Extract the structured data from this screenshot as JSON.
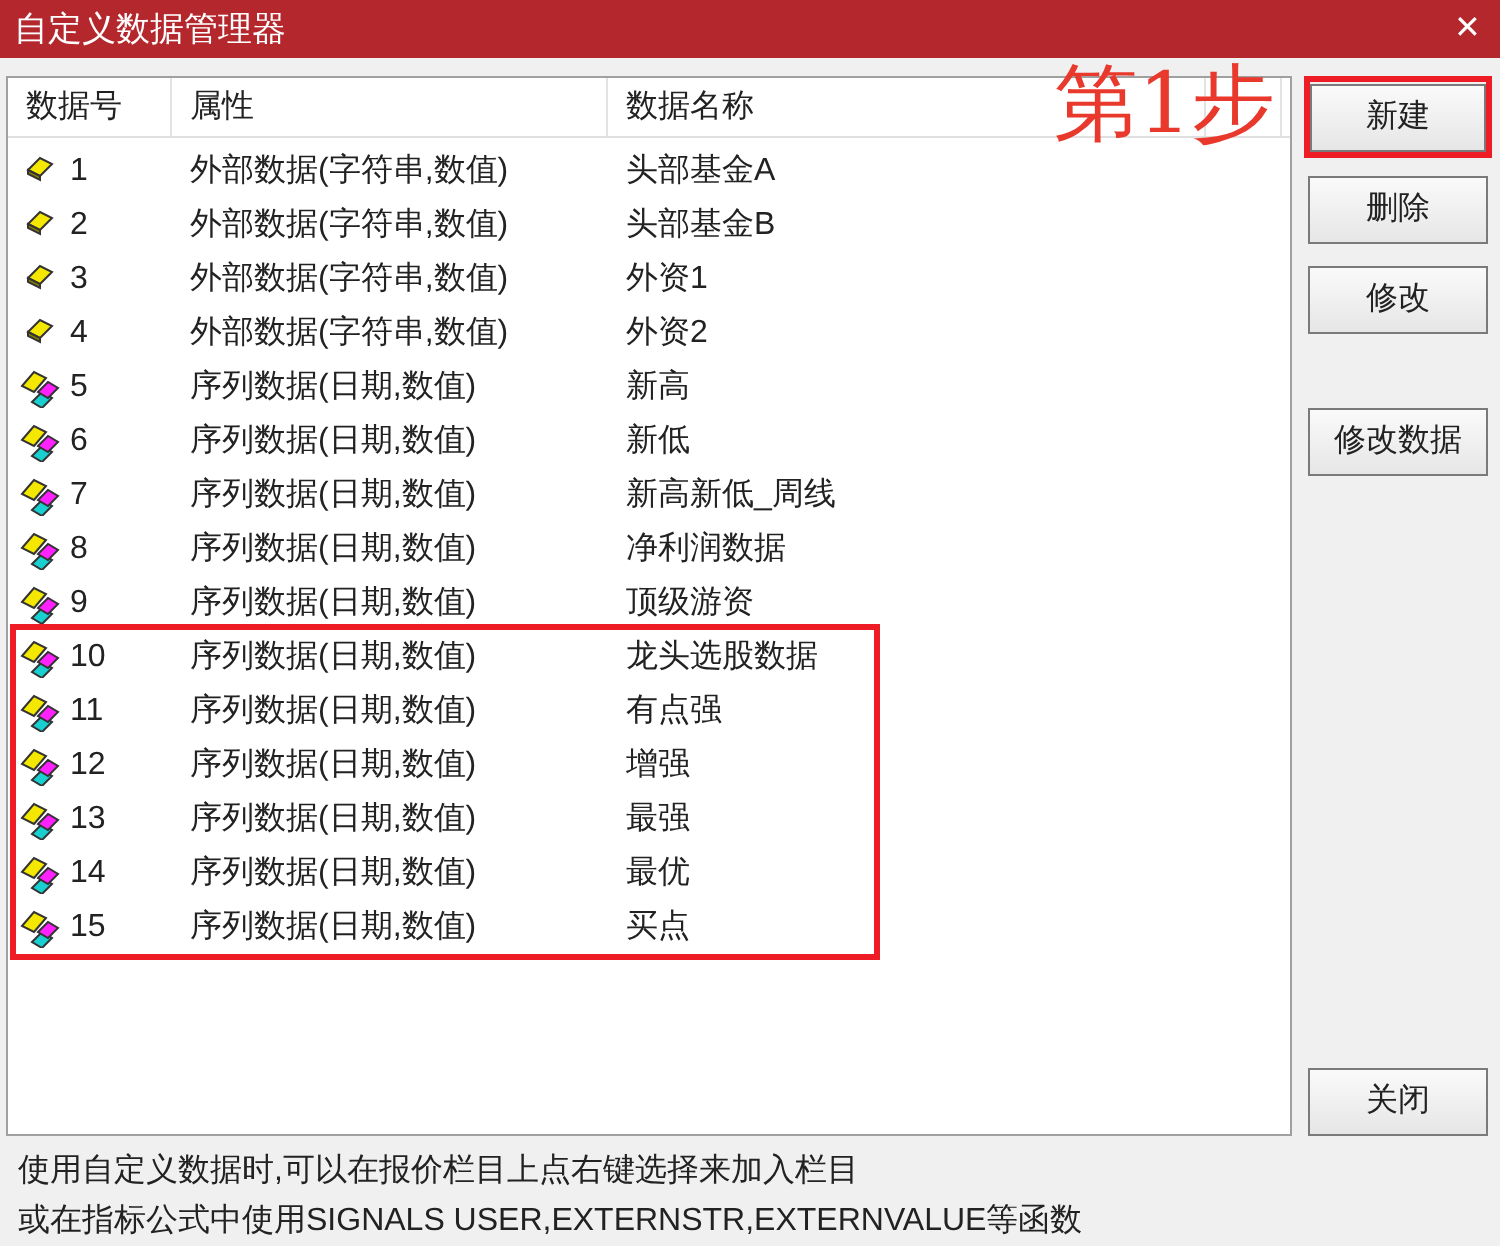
{
  "window": {
    "title": "自定义数据管理器",
    "close": "✕"
  },
  "table": {
    "columns": [
      "数据号",
      "属性",
      "数据名称"
    ],
    "rows": [
      {
        "kind": "external",
        "id": "1",
        "attribute": "外部数据(字符串,数值)",
        "name": "头部基金A",
        "highlighted": false
      },
      {
        "kind": "external",
        "id": "2",
        "attribute": "外部数据(字符串,数值)",
        "name": "头部基金B",
        "highlighted": false
      },
      {
        "kind": "external",
        "id": "3",
        "attribute": "外部数据(字符串,数值)",
        "name": "外资1",
        "highlighted": false
      },
      {
        "kind": "external",
        "id": "4",
        "attribute": "外部数据(字符串,数值)",
        "name": "外资2",
        "highlighted": false
      },
      {
        "kind": "series",
        "id": "5",
        "attribute": "序列数据(日期,数值)",
        "name": "新高",
        "highlighted": false
      },
      {
        "kind": "series",
        "id": "6",
        "attribute": "序列数据(日期,数值)",
        "name": "新低",
        "highlighted": false
      },
      {
        "kind": "series",
        "id": "7",
        "attribute": "序列数据(日期,数值)",
        "name": "新高新低_周线",
        "highlighted": false
      },
      {
        "kind": "series",
        "id": "8",
        "attribute": "序列数据(日期,数值)",
        "name": "净利润数据",
        "highlighted": false
      },
      {
        "kind": "series",
        "id": "9",
        "attribute": "序列数据(日期,数值)",
        "name": "顶级游资",
        "highlighted": false
      },
      {
        "kind": "series",
        "id": "10",
        "attribute": "序列数据(日期,数值)",
        "name": "龙头选股数据",
        "highlighted": true
      },
      {
        "kind": "series",
        "id": "11",
        "attribute": "序列数据(日期,数值)",
        "name": "有点强",
        "highlighted": true
      },
      {
        "kind": "series",
        "id": "12",
        "attribute": "序列数据(日期,数值)",
        "name": "增强",
        "highlighted": true
      },
      {
        "kind": "series",
        "id": "13",
        "attribute": "序列数据(日期,数值)",
        "name": "最强",
        "highlighted": true
      },
      {
        "kind": "series",
        "id": "14",
        "attribute": "序列数据(日期,数值)",
        "name": "最优",
        "highlighted": true
      },
      {
        "kind": "series",
        "id": "15",
        "attribute": "序列数据(日期,数值)",
        "name": "买点",
        "highlighted": true
      }
    ]
  },
  "annotation": {
    "label": "第1步"
  },
  "buttons": [
    {
      "label": "新建",
      "highlighted": true
    },
    {
      "label": "删除",
      "highlighted": false
    },
    {
      "label": "修改",
      "highlighted": false
    },
    {
      "label": "修改数据",
      "highlighted": false
    },
    {
      "label": "关闭",
      "highlighted": false
    }
  ],
  "hint_lines": [
    "使用自定义数据时,可以在报价栏目上点右键选择来加入栏目",
    "或在指标公式中使用SIGNALS USER,EXTERNSTR,EXTERNVALUE等函数"
  ]
}
